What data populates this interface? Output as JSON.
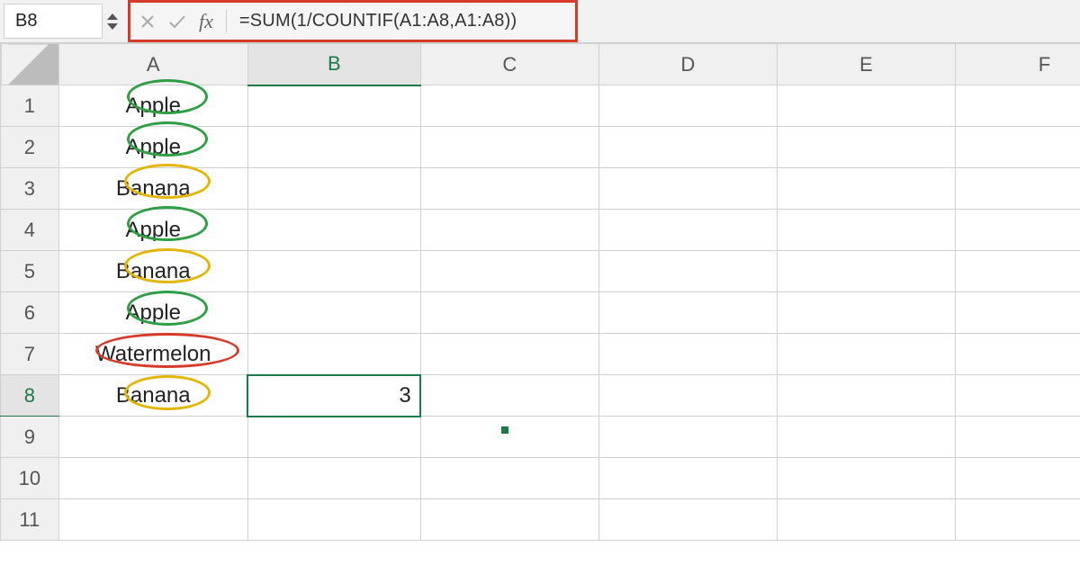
{
  "namebox": {
    "ref": "B8"
  },
  "formula_bar": {
    "cancel_title": "Cancel",
    "confirm_title": "Enter",
    "fx_label": "fx",
    "formula": "=SUM(1/COUNTIF(A1:A8,A1:A8))"
  },
  "columns": [
    "A",
    "B",
    "C",
    "D",
    "E",
    "F"
  ],
  "rows": [
    "1",
    "2",
    "3",
    "4",
    "5",
    "6",
    "7",
    "8",
    "9",
    "10",
    "11"
  ],
  "active": {
    "col": "B",
    "row": "8"
  },
  "cells": {
    "A1": "Apple",
    "A2": "Apple",
    "A3": "Banana",
    "A4": "Apple",
    "A5": "Banana",
    "A6": "Apple",
    "A7": "Watermelon",
    "A8": "Banana",
    "B8": "3"
  },
  "annotations": [
    {
      "cell": "A1",
      "color": "green"
    },
    {
      "cell": "A2",
      "color": "green"
    },
    {
      "cell": "A3",
      "color": "yellow"
    },
    {
      "cell": "A4",
      "color": "green"
    },
    {
      "cell": "A5",
      "color": "yellow"
    },
    {
      "cell": "A6",
      "color": "green"
    },
    {
      "cell": "A7",
      "color": "red"
    },
    {
      "cell": "A8",
      "color": "yellow"
    }
  ],
  "annotation_colors": {
    "green": "#2f9e44",
    "yellow": "#e3b505",
    "red": "#d63a2b"
  },
  "highlight_box_color": "#d63a2b"
}
